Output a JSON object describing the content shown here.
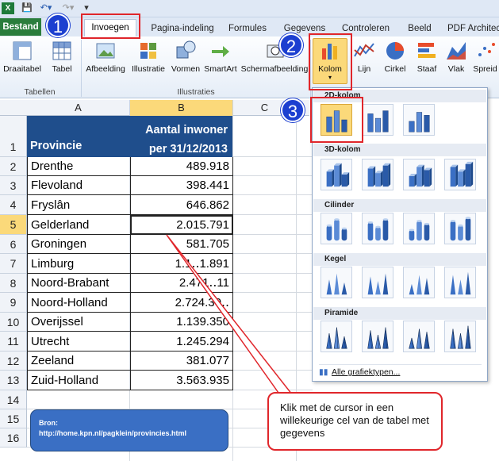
{
  "tabs": {
    "file": "Bestand",
    "active": "Invoegen",
    "others": [
      "Pagina-indeling",
      "Formules",
      "Gegevens",
      "Controleren",
      "Beeld",
      "PDF Architect"
    ]
  },
  "ribbon": {
    "buttons": {
      "draaitabel": "Draaitabel",
      "tabel": "Tabel",
      "afbeelding": "Afbeelding",
      "illustratie": "Illustratie",
      "vormen": "Vormen",
      "smartart": "SmartArt",
      "schermafbeelding": "Schermafbeelding",
      "kolom": "Kolom",
      "lijn": "Lijn",
      "cirkel": "Cirkel",
      "staaf": "Staaf",
      "vlak": "Vlak",
      "spreid": "Spreid"
    },
    "groups": {
      "tabellen": "Tabellen",
      "illustraties": "Illustraties"
    }
  },
  "columns": [
    "A",
    "B",
    "C"
  ],
  "rows": [
    "1",
    "2",
    "3",
    "4",
    "5",
    "6",
    "7",
    "8",
    "9",
    "10",
    "11",
    "12",
    "13",
    "14",
    "15",
    "16"
  ],
  "sheet": {
    "header_a": "Provincie",
    "header_b1": "Aantal inwoner",
    "header_b2": "per 31/12/2013",
    "data": [
      [
        "Drenthe",
        "489.918"
      ],
      [
        "Flevoland",
        "398.441"
      ],
      [
        "Fryslân",
        "646.862"
      ],
      [
        "Gelderland",
        "2.015.791"
      ],
      [
        "Groningen",
        "581.705"
      ],
      [
        "Limburg",
        "1.1‥1.891"
      ],
      [
        "Noord-Brabant",
        "2.471‥11"
      ],
      [
        "Noord-Holland",
        "2.724.30‥"
      ],
      [
        "Overijssel",
        "1.139.350"
      ],
      [
        "Utrecht",
        "1.245.294"
      ],
      [
        "Zeeland",
        "381.077"
      ],
      [
        "Zuid-Holland",
        "3.563.935"
      ]
    ]
  },
  "source_box": {
    "line1": "Bron:",
    "line2": "http://home.kpn.nl/pagklein/provincies.html"
  },
  "menu": {
    "sections": [
      "2D-kolom",
      "3D-kolom",
      "Cilinder",
      "Kegel",
      "Piramide"
    ],
    "all_types": "Alle grafiektypen..."
  },
  "callout": "Klik met de cursor in een willekeurige cel van de tabel met gegevens",
  "badges": [
    "1",
    "2",
    "3"
  ],
  "colors": {
    "header_fill": "#1f4e8c",
    "accent_red": "#e0262b",
    "badge_blue": "#1c3fd0",
    "source_fill": "#3a6fc4",
    "file_tab": "#2a7d3c"
  }
}
